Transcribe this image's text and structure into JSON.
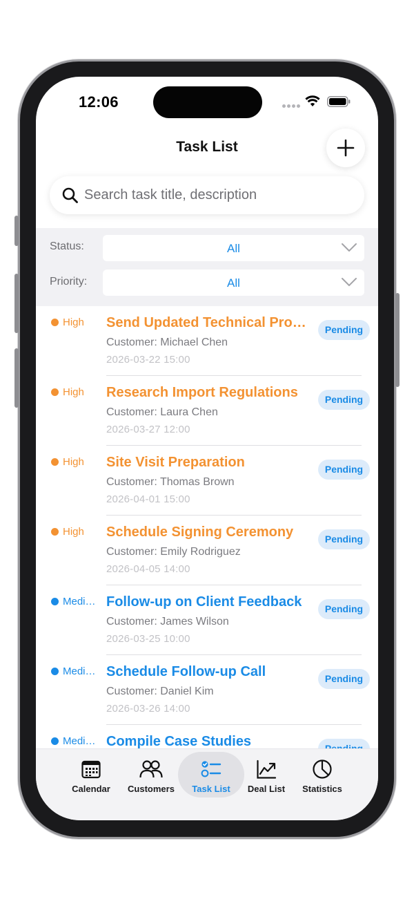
{
  "status_bar": {
    "time": "12:06"
  },
  "nav": {
    "title": "Task List"
  },
  "search": {
    "placeholder": "Search task title, description",
    "value": ""
  },
  "filters": {
    "status": {
      "label": "Status:",
      "value": "All"
    },
    "priority": {
      "label": "Priority:",
      "value": "All"
    }
  },
  "colors": {
    "high": "#f39232",
    "medium": "#1a8be6",
    "accent": "#1a8be6",
    "badge_bg": "#dcebfa"
  },
  "tasks": [
    {
      "priority": "High",
      "level": "high",
      "title": "Send Updated Technical Proposal",
      "customer": "Customer: Michael Chen",
      "time": "2026-03-22 15:00",
      "status": "Pending"
    },
    {
      "priority": "High",
      "level": "high",
      "title": "Research Import Regulations",
      "customer": "Customer: Laura Chen",
      "time": "2026-03-27 12:00",
      "status": "Pending"
    },
    {
      "priority": "High",
      "level": "high",
      "title": "Site Visit Preparation",
      "customer": "Customer: Thomas Brown",
      "time": "2026-04-01 15:00",
      "status": "Pending"
    },
    {
      "priority": "High",
      "level": "high",
      "title": "Schedule Signing Ceremony",
      "customer": "Customer: Emily Rodriguez",
      "time": "2026-04-05 14:00",
      "status": "Pending"
    },
    {
      "priority": "Medium",
      "level": "medium",
      "title": "Follow-up on Client Feedback",
      "customer": "Customer: James Wilson",
      "time": "2026-03-25 10:00",
      "status": "Pending"
    },
    {
      "priority": "Medium",
      "level": "medium",
      "title": "Schedule Follow-up Call",
      "customer": "Customer: Daniel Kim",
      "time": "2026-03-26 14:00",
      "status": "Pending"
    },
    {
      "priority": "Medium",
      "level": "medium",
      "title": "Compile Case Studies",
      "customer": "",
      "time": "",
      "status": "Pending"
    }
  ],
  "tabs": [
    {
      "label": "Calendar",
      "icon": "calendar-icon",
      "active": false
    },
    {
      "label": "Customers",
      "icon": "customers-icon",
      "active": false
    },
    {
      "label": "Task List",
      "icon": "task-list-icon",
      "active": true
    },
    {
      "label": "Deal List",
      "icon": "deal-chart-icon",
      "active": false
    },
    {
      "label": "Statistics",
      "icon": "pie-chart-icon",
      "active": false
    }
  ]
}
